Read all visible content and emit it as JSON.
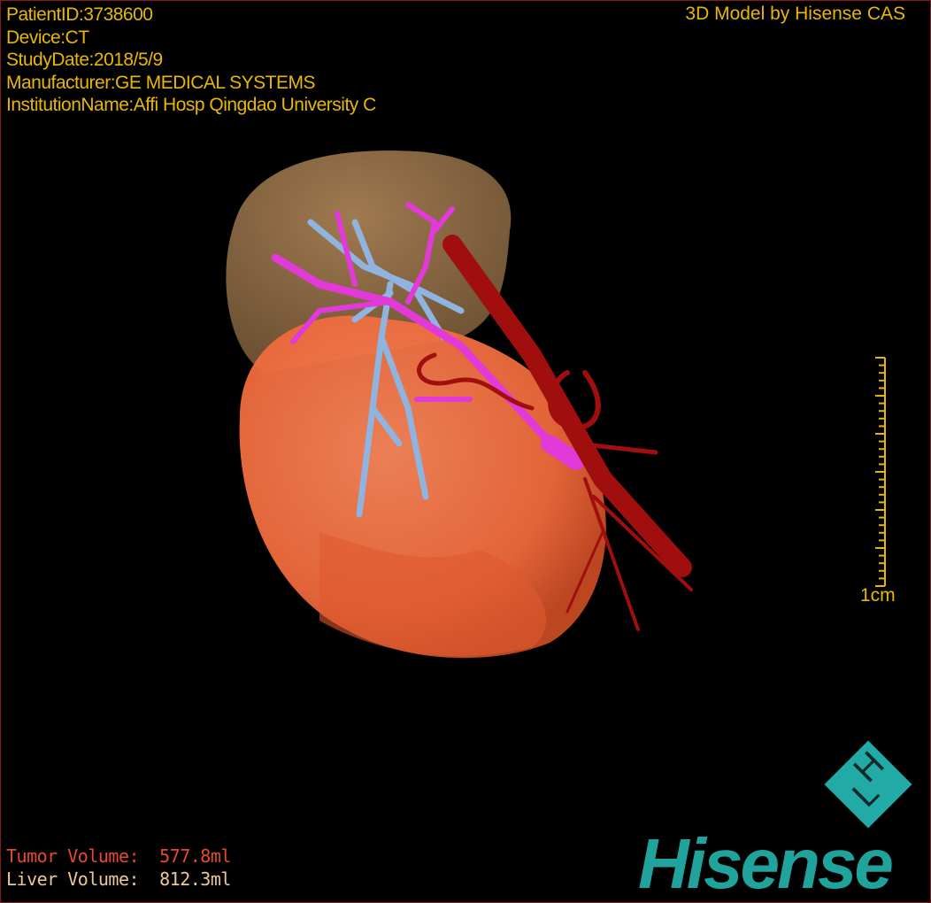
{
  "overlay": {
    "patient_id": "PatientID:3738600",
    "device": "Device:CT",
    "study_date": "StudyDate:2018/5/9",
    "manufacturer": "Manufacturer:GE MEDICAL SYSTEMS",
    "institution": "InstitutionName:Affi Hosp Qingdao University C",
    "credit": "3D Model by Hisense CAS"
  },
  "volumes": {
    "tumor": "Tumor Volume:  577.8ml",
    "liver": "Liver Volume:  812.3ml"
  },
  "scale_bar": {
    "label": "1cm"
  },
  "brand": {
    "name": "Hisense",
    "logo_letters": "HL"
  },
  "colors": {
    "text": "#e8b800",
    "tumor": "#e8492c",
    "liver": "#8a6a45",
    "portal_vein": "#8fb4e0",
    "hepatic_vein": "#e23ad8",
    "artery": "#a00e0e",
    "brand": "#1fa39c",
    "border": "#8a1a1a"
  }
}
